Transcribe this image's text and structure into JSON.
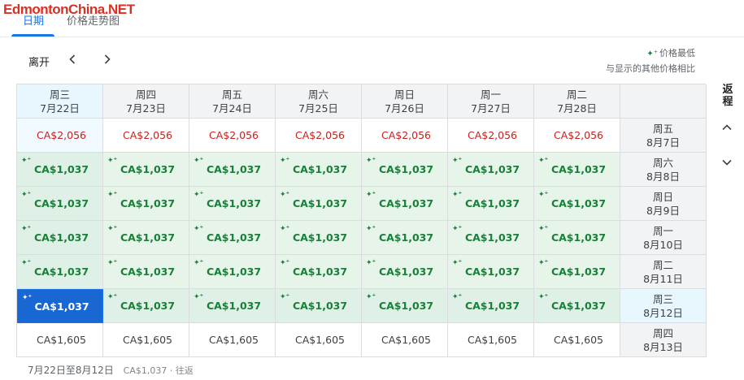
{
  "watermark": "EdmontonChina.NET",
  "tabs": [
    {
      "label": "日期"
    },
    {
      "label": "价格走势图"
    }
  ],
  "toolbar": {
    "depart_label": "离开",
    "legend_line1": "价格最低",
    "legend_line2": "与显示的其他价格相比",
    "return_label": "返程"
  },
  "columns": [
    {
      "day": "周三",
      "date": "7月22日"
    },
    {
      "day": "周四",
      "date": "7月23日"
    },
    {
      "day": "周五",
      "date": "7月24日"
    },
    {
      "day": "周六",
      "date": "7月25日"
    },
    {
      "day": "周日",
      "date": "7月26日"
    },
    {
      "day": "周一",
      "date": "7月27日"
    },
    {
      "day": "周二",
      "date": "7月28日"
    }
  ],
  "rows": [
    {
      "day": "周五",
      "date": "8月7日",
      "prices": [
        "CA$2,056",
        "CA$2,056",
        "CA$2,056",
        "CA$2,056",
        "CA$2,056",
        "CA$2,056",
        "CA$2,056"
      ],
      "kind": "high"
    },
    {
      "day": "周六",
      "date": "8月8日",
      "prices": [
        "CA$1,037",
        "CA$1,037",
        "CA$1,037",
        "CA$1,037",
        "CA$1,037",
        "CA$1,037",
        "CA$1,037"
      ],
      "kind": "low"
    },
    {
      "day": "周日",
      "date": "8月9日",
      "prices": [
        "CA$1,037",
        "CA$1,037",
        "CA$1,037",
        "CA$1,037",
        "CA$1,037",
        "CA$1,037",
        "CA$1,037"
      ],
      "kind": "low"
    },
    {
      "day": "周一",
      "date": "8月10日",
      "prices": [
        "CA$1,037",
        "CA$1,037",
        "CA$1,037",
        "CA$1,037",
        "CA$1,037",
        "CA$1,037",
        "CA$1,037"
      ],
      "kind": "low"
    },
    {
      "day": "周二",
      "date": "8月11日",
      "prices": [
        "CA$1,037",
        "CA$1,037",
        "CA$1,037",
        "CA$1,037",
        "CA$1,037",
        "CA$1,037",
        "CA$1,037"
      ],
      "kind": "low"
    },
    {
      "day": "周三",
      "date": "8月12日",
      "prices": [
        "CA$1,037",
        "CA$1,037",
        "CA$1,037",
        "CA$1,037",
        "CA$1,037",
        "CA$1,037",
        "CA$1,037"
      ],
      "kind": "low"
    },
    {
      "day": "周四",
      "date": "8月13日",
      "prices": [
        "CA$1,605",
        "CA$1,605",
        "CA$1,605",
        "CA$1,605",
        "CA$1,605",
        "CA$1,605",
        "CA$1,605"
      ],
      "kind": "mid"
    }
  ],
  "selection": {
    "column": 0,
    "row": 5
  },
  "summary": {
    "dates": "7月22日至8月12日",
    "detail": "CA$1,037 · 往返"
  },
  "colors": {
    "accent": "#1a73e8",
    "low": "#188038",
    "high": "#c5221f",
    "selected": "#1967d2"
  },
  "icons": {
    "low_price": "sparkle-icon",
    "prev": "chevron-left-icon",
    "next": "chevron-right-icon",
    "up": "chevron-up-icon",
    "down": "chevron-down-icon"
  }
}
